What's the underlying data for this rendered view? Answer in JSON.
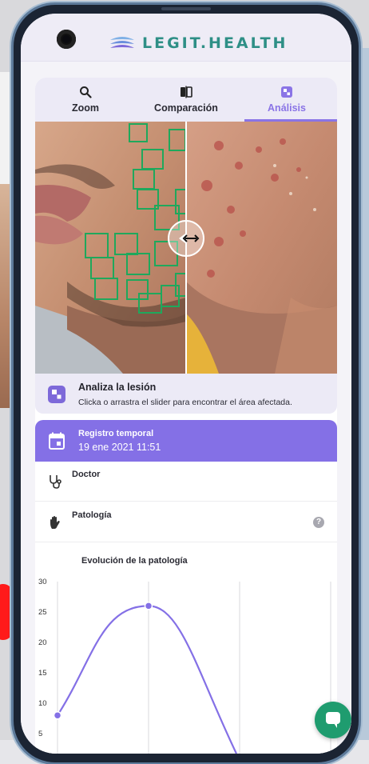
{
  "app": {
    "logo_text": "LEGIT.HEALTH"
  },
  "tabs": [
    {
      "label": "Zoom",
      "icon": "search-icon"
    },
    {
      "label": "Comparación",
      "icon": "compare-icon"
    },
    {
      "label": "Análisis",
      "icon": "analysis-icon",
      "active": true
    }
  ],
  "analiza": {
    "title": "Analiza la lesión",
    "subtitle": "Clicka o arrastra el slider para encontrar el área afectada."
  },
  "registro": {
    "title": "Registro temporal",
    "date": "19 ene 2021 11:51"
  },
  "rows": {
    "doctor_label": "Doctor",
    "patologia_label": "Patología",
    "help_symbol": "?"
  },
  "chart_data": {
    "type": "line",
    "title": "Evolución de la patología",
    "yticks": [
      "30",
      "25",
      "20",
      "15",
      "10",
      "5"
    ],
    "ylim": [
      5,
      30
    ],
    "points": [
      {
        "x": 0,
        "y": 8
      },
      {
        "x": 1,
        "y": 26
      }
    ],
    "grid": true
  },
  "colors": {
    "accent": "#8470e6",
    "logo": "#2e8f86",
    "detection_box": "#1fa85c",
    "chat_button": "#1f9c6f"
  }
}
